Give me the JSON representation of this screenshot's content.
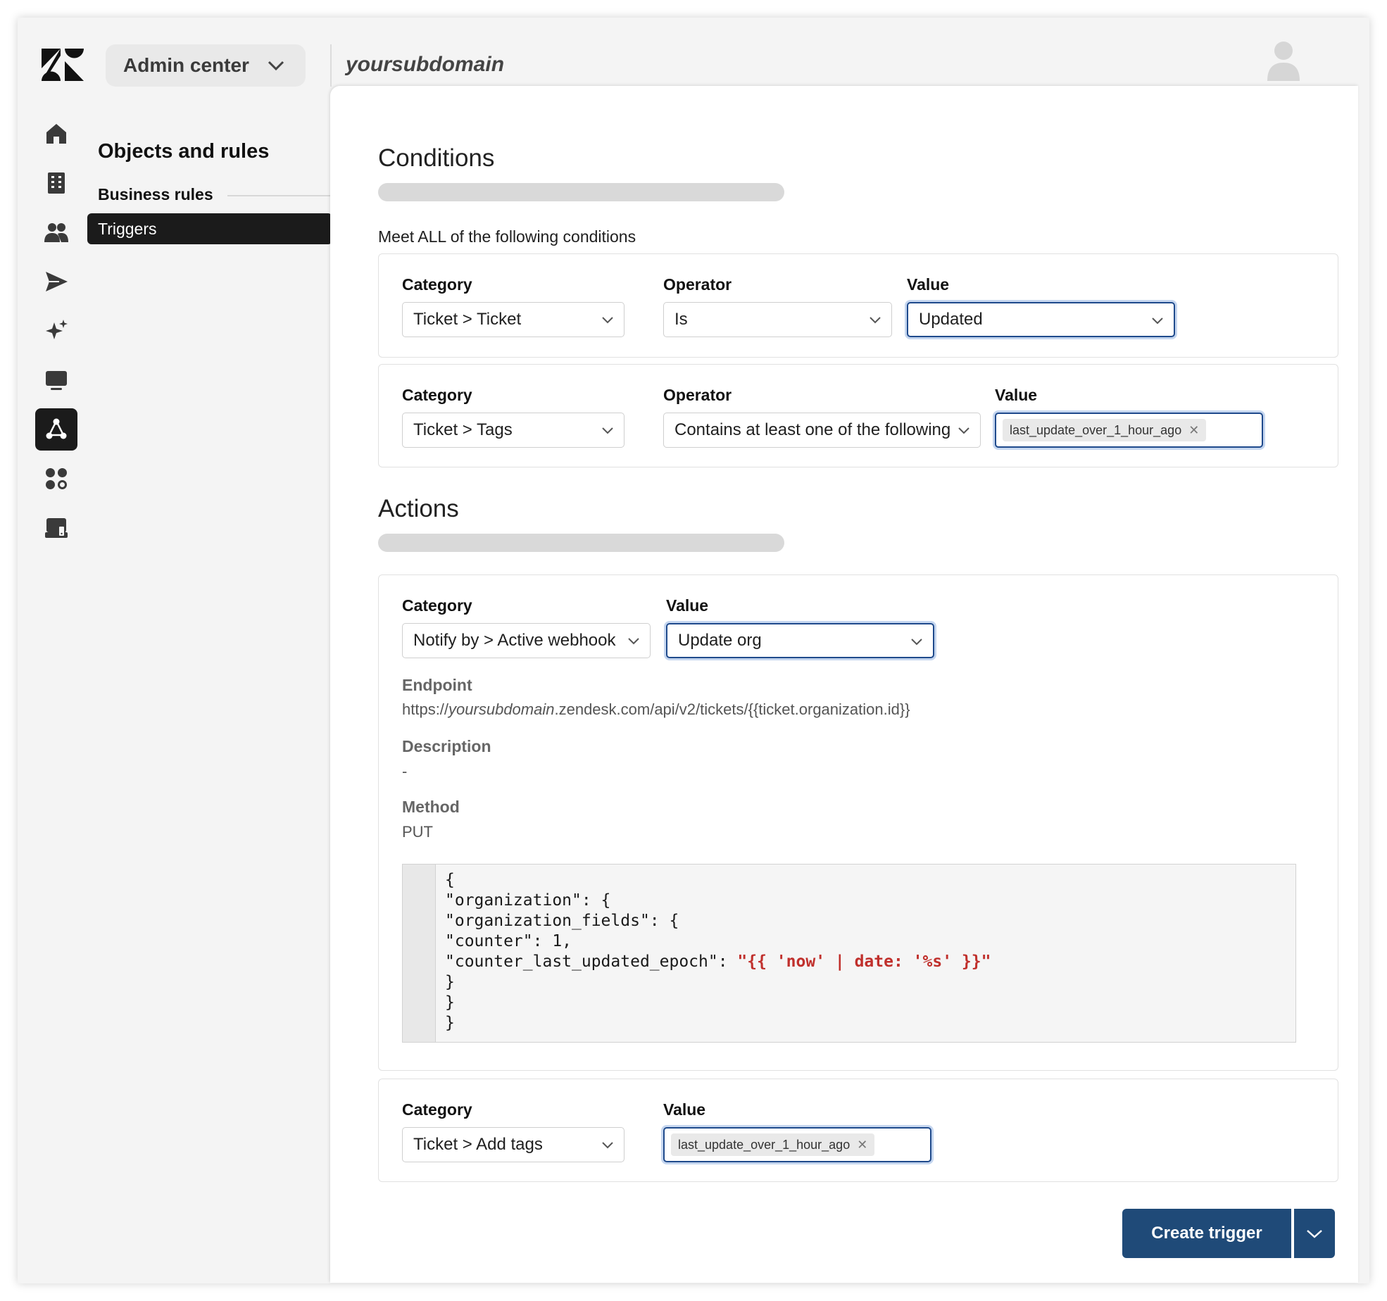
{
  "header": {
    "product_switcher": "Admin center",
    "subdomain": "yoursubdomain"
  },
  "nav": {
    "icons": [
      "home-icon",
      "building-icon",
      "people-icon",
      "send-icon",
      "sparkle-icon",
      "workspace-icon",
      "objects-rules-icon",
      "apps-icon",
      "devices-icon"
    ],
    "active_icon": "objects-rules-icon"
  },
  "subnav": {
    "title": "Objects and rules",
    "section": "Business rules",
    "active_item": "Triggers"
  },
  "conditions": {
    "heading": "Conditions",
    "match_text": "Meet ALL of the following conditions",
    "rows": [
      {
        "category_label": "Category",
        "category": "Ticket > Ticket",
        "operator_label": "Operator",
        "operator": "Is",
        "value_label": "Value",
        "value": "Updated"
      },
      {
        "category_label": "Category",
        "category": "Ticket > Tags",
        "operator_label": "Operator",
        "operator": "Contains at least one of the following",
        "value_label": "Value",
        "value_tag": "last_update_over_1_hour_ago"
      }
    ]
  },
  "actions": {
    "heading": "Actions",
    "webhook": {
      "category_label": "Category",
      "category": "Notify by > Active webhook",
      "value_label": "Value",
      "value": "Update org",
      "endpoint_label": "Endpoint",
      "endpoint_prefix": "https://",
      "endpoint_subdomain": "yoursubdomain",
      "endpoint_suffix": ".zendesk.com/api/v2/tickets/{{ticket.organization.id}}",
      "description_label": "Description",
      "description": "-",
      "method_label": "Method",
      "method": "PUT",
      "body_lines": [
        "{",
        "\"organization\": {",
        "\"organization_fields\": {",
        "\"counter\": 1,",
        "\"counter_last_updated_epoch\": ",
        "}",
        "}",
        "}"
      ],
      "body_liquid": "\"{{ 'now' | date: '%s' }}\""
    },
    "add_tags": {
      "category_label": "Category",
      "category": "Ticket > Add tags",
      "value_label": "Value",
      "value_tag": "last_update_over_1_hour_ago"
    }
  },
  "footer": {
    "create_button": "Create trigger"
  },
  "colors": {
    "primary": "#1f4a78",
    "focus": "#1f4a8c",
    "liquid_string": "#c0302c"
  }
}
